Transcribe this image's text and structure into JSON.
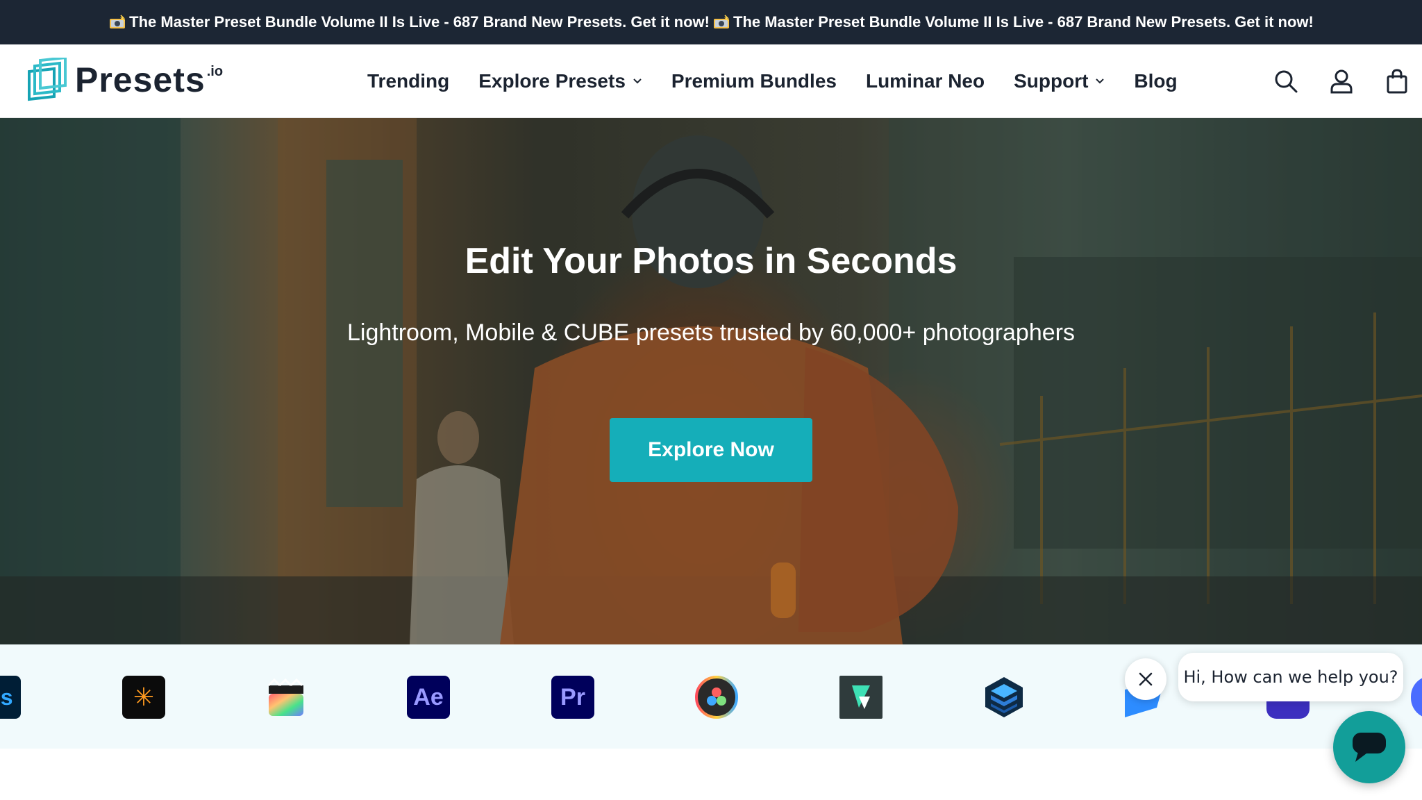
{
  "announcement": {
    "messages": [
      "The Master Preset Bundle Volume II Is Live - 687 Brand New Presets. Get it now!",
      "The Master Preset Bundle Volume II Is Live - 687 Brand New Presets. Get it now!"
    ]
  },
  "logo": {
    "text": "Presets",
    "sup": ".io"
  },
  "nav": {
    "items": [
      {
        "label": "Trending"
      },
      {
        "label": "Explore Presets"
      },
      {
        "label": "Premium Bundles"
      },
      {
        "label": "Luminar Neo"
      },
      {
        "label": "Support"
      },
      {
        "label": "Blog"
      }
    ]
  },
  "hero": {
    "title": "Edit Your Photos in Seconds",
    "subtitle": "Lightroom, Mobile & CUBE presets trusted by 60,000+ photographers",
    "cta": "Explore Now"
  },
  "apps": [
    {
      "name": "photoshop-icon",
      "label": "Ps",
      "bg": "#001e36",
      "fg": "#31a8ff"
    },
    {
      "name": "luminar-icon",
      "label": "✳",
      "bg": "#0b0b0b",
      "fg": "#ff9a1f"
    },
    {
      "name": "final-cut-pro-icon",
      "label": "",
      "bg": "#ffffff",
      "fg": "#000000"
    },
    {
      "name": "after-effects-icon",
      "label": "Ae",
      "bg": "#00005b",
      "fg": "#9999ff"
    },
    {
      "name": "premiere-pro-icon",
      "label": "Pr",
      "bg": "#00005b",
      "fg": "#9999ff"
    },
    {
      "name": "davinci-resolve-icon",
      "label": "",
      "bg": "#1e1e1e",
      "fg": "#ffffff"
    },
    {
      "name": "filmora-icon",
      "label": "",
      "bg": "#2f3b3c",
      "fg": "#3ee0b5"
    },
    {
      "name": "capture-one-icon",
      "label": "",
      "bg": "#ffffff",
      "fg": "#000000"
    },
    {
      "name": "play-icon",
      "label": "",
      "bg": "#ffffff",
      "fg": "#0a84ff"
    }
  ],
  "chat": {
    "prompt": "Hi, How can we help you?"
  },
  "colors": {
    "accent": "#15aeb9",
    "announce_bg": "#1c2634",
    "chat": "#129e99"
  }
}
